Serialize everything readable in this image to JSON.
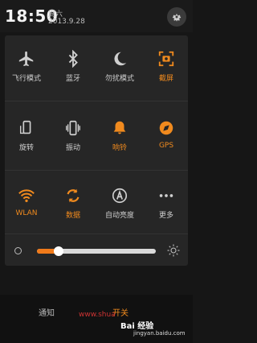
{
  "status": {
    "time": "18:50",
    "weekday": "周六",
    "date": "2013.9.28"
  },
  "toggles": [
    {
      "label": "飞行模式",
      "icon": "airplane-icon",
      "on": false
    },
    {
      "label": "蓝牙",
      "icon": "bluetooth-icon",
      "on": false
    },
    {
      "label": "勿扰模式",
      "icon": "moon-icon",
      "on": false
    },
    {
      "label": "截屏",
      "icon": "screenshot-icon",
      "on": true
    },
    {
      "label": "旋转",
      "icon": "rotate-icon",
      "on": false
    },
    {
      "label": "振动",
      "icon": "vibrate-icon",
      "on": false
    },
    {
      "label": "响铃",
      "icon": "bell-icon",
      "on": true
    },
    {
      "label": "GPS",
      "icon": "gps-icon",
      "on": true
    },
    {
      "label": "WLAN",
      "icon": "wifi-icon",
      "on": true
    },
    {
      "label": "数据",
      "icon": "data-icon",
      "on": true
    },
    {
      "label": "自动亮度",
      "icon": "auto-brightness-icon",
      "on": false
    },
    {
      "label": "更多",
      "icon": "more-icon",
      "on": false
    }
  ],
  "brightness": {
    "level": 0.18
  },
  "tabs": {
    "notify": "通知",
    "toggle": "开关"
  },
  "watermark": {
    "url": "www.shua",
    "brand": "Bai 经验",
    "site": "jingyan.baidu.com"
  },
  "colors": {
    "accent": "#f08a1e",
    "inactive": "#cfcfcf",
    "panel": "#262626"
  }
}
